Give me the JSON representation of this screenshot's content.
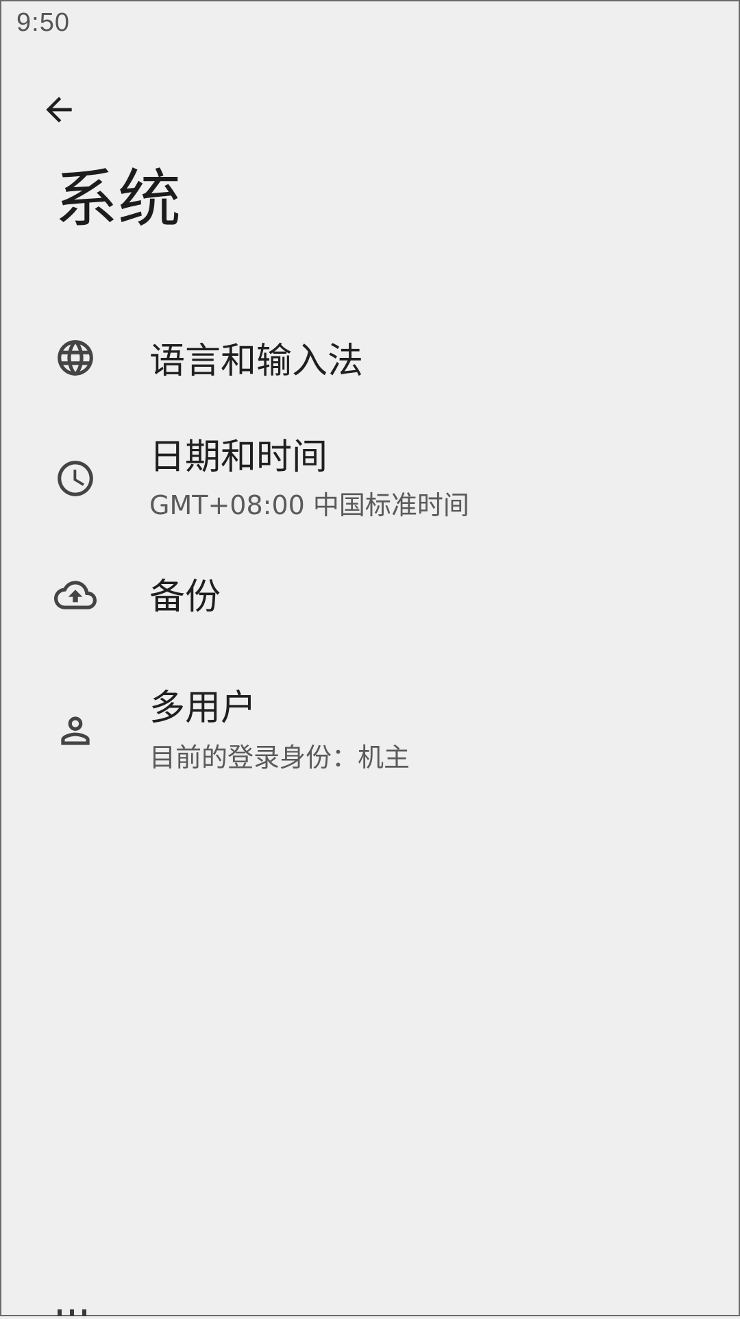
{
  "status_bar": {
    "time": "9:50"
  },
  "header": {
    "back_icon": "arrow-back-icon",
    "title": "系统"
  },
  "settings": [
    {
      "icon": "globe-icon",
      "title": "语言和输入法",
      "subtitle": ""
    },
    {
      "icon": "clock-icon",
      "title": "日期和时间",
      "subtitle": "GMT+08:00 中国标准时间"
    },
    {
      "icon": "cloud-upload-icon",
      "title": "备份",
      "subtitle": ""
    },
    {
      "icon": "person-icon",
      "title": "多用户",
      "subtitle": "目前的登录身份：机主"
    }
  ],
  "colors": {
    "background": "#efefef",
    "text_primary": "#1f1f1f",
    "text_secondary": "#5a5a5a",
    "icon": "#444444"
  }
}
